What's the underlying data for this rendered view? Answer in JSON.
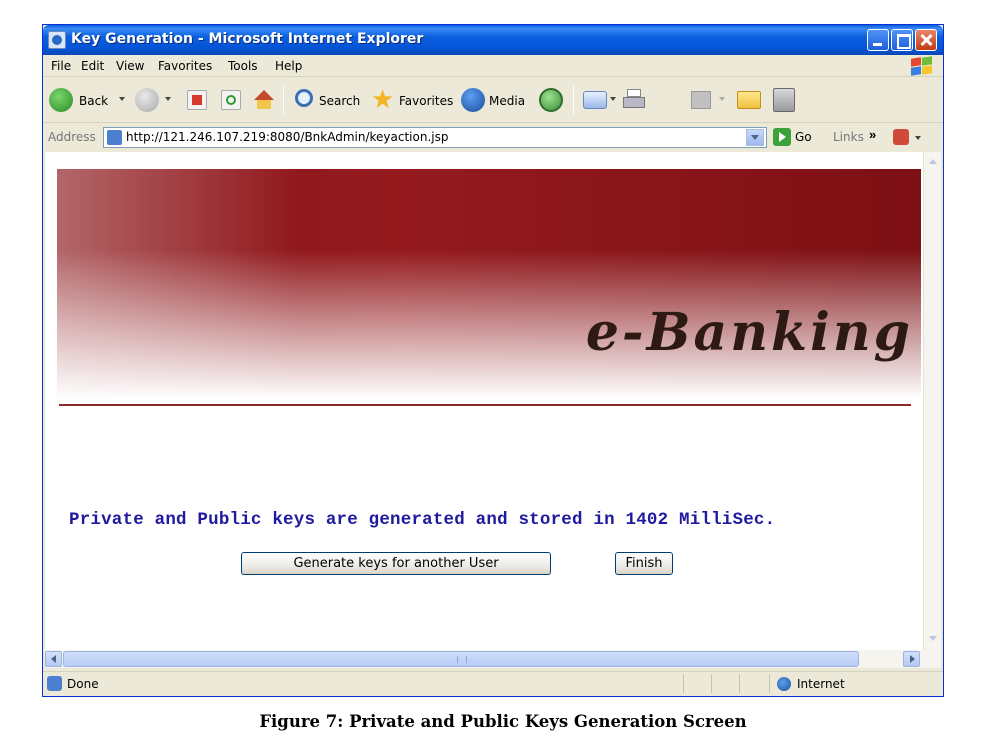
{
  "window": {
    "title": "Key Generation - Microsoft Internet Explorer"
  },
  "menu": {
    "items": [
      "File",
      "Edit",
      "View",
      "Favorites",
      "Tools",
      "Help"
    ]
  },
  "toolbar": {
    "back_label": "Back",
    "search_label": "Search",
    "favorites_label": "Favorites",
    "media_label": "Media"
  },
  "address": {
    "label": "Address",
    "url": "http://121.246.107.219:8080/BnkAdmin/keyaction.jsp",
    "go_label": "Go",
    "links_label": "Links",
    "links_chevron": "»"
  },
  "page": {
    "brand": "e-Banking",
    "message": "Private and Public keys are generated and stored in 1402 MilliSec.",
    "generate_button": "Generate keys for another User",
    "finish_button": "Finish"
  },
  "status": {
    "text": "Done",
    "zone": "Internet"
  },
  "caption": "Figure 7: Private and Public Keys Generation Screen",
  "colors": {
    "banner_red": "#941a1e",
    "message_blue": "#1f1aa0",
    "brand_text": "#2e1a14",
    "rule": "#8b2c2c"
  }
}
